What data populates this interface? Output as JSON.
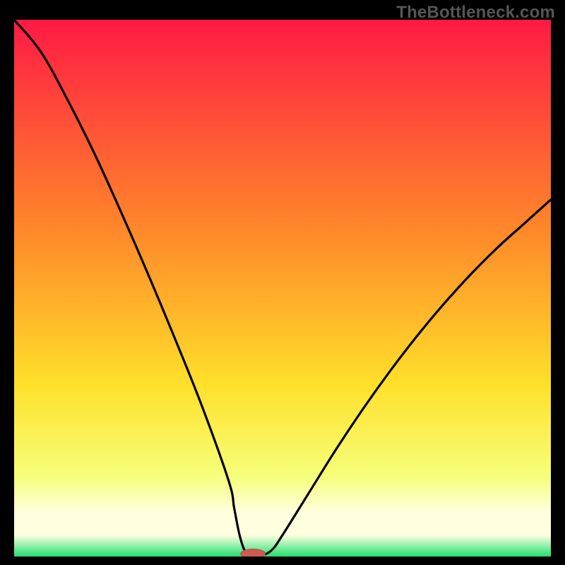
{
  "watermark": "TheBottleneck.com",
  "colors": {
    "frame_bg": "#000000",
    "curve": "#000000",
    "marker_fill": "#cf5a55",
    "marker_stroke": "#b94b46",
    "grad_top": "#ff1a44",
    "grad_mid1": "#ff8a2a",
    "grad_mid2": "#ffe02a",
    "grad_mid3": "#f6ff7a",
    "grad_bottom_fade": "#ffffe0",
    "grad_green": "#22e070"
  },
  "chart_data": {
    "type": "line",
    "title": "",
    "xlabel": "",
    "ylabel": "",
    "xlim": [
      0,
      100
    ],
    "ylim": [
      0,
      100
    ],
    "grid": false,
    "legend": false,
    "annotations": [],
    "series": [
      {
        "name": "bottleneck-curve",
        "x": [
          0,
          5,
          10,
          15,
          20,
          25,
          30,
          35,
          40,
          41,
          42,
          43,
          44,
          46,
          48,
          50,
          55,
          60,
          65,
          70,
          75,
          80,
          85,
          90,
          95,
          100
        ],
        "values": [
          100,
          94,
          85,
          75,
          64,
          52.5,
          40.5,
          28,
          14,
          9,
          4,
          1,
          0.2,
          0.2,
          1.2,
          4,
          12,
          20,
          27.5,
          34.5,
          41,
          47,
          52.5,
          57.5,
          62,
          66.5
        ]
      }
    ],
    "marker": {
      "x": 44.5,
      "y": 0.5,
      "rx": 2.3,
      "ry": 0.9
    },
    "gradient_stops": [
      {
        "offset": 0,
        "value": 100
      },
      {
        "offset": 40,
        "value": 60
      },
      {
        "offset": 68,
        "value": 32
      },
      {
        "offset": 85,
        "value": 15
      },
      {
        "offset": 93,
        "value": 7
      },
      {
        "offset": 100,
        "value": 0
      }
    ]
  }
}
